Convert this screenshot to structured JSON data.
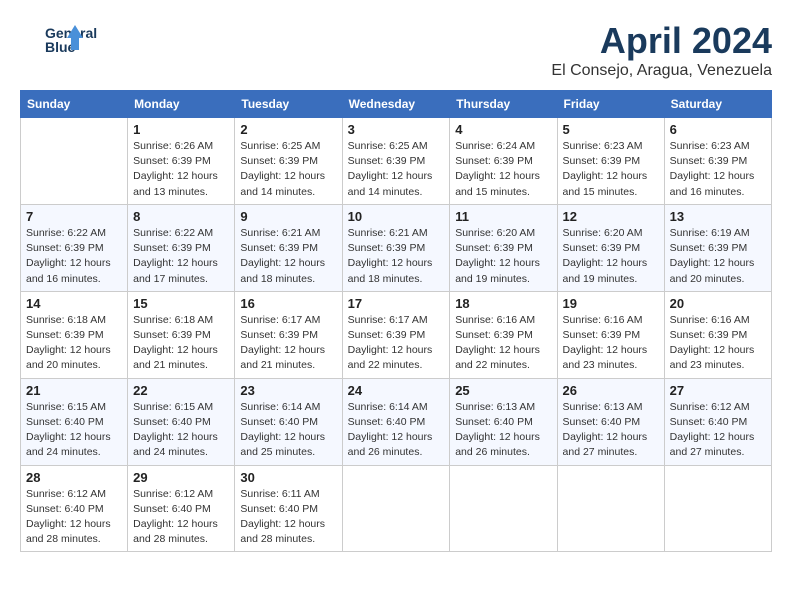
{
  "header": {
    "logo_line1": "General",
    "logo_line2": "Blue",
    "month": "April 2024",
    "location": "El Consejo, Aragua, Venezuela"
  },
  "days_of_week": [
    "Sunday",
    "Monday",
    "Tuesday",
    "Wednesday",
    "Thursday",
    "Friday",
    "Saturday"
  ],
  "weeks": [
    [
      null,
      {
        "day": 1,
        "sunrise": "6:26 AM",
        "sunset": "6:39 PM",
        "daylight": "12 hours and 13 minutes."
      },
      {
        "day": 2,
        "sunrise": "6:25 AM",
        "sunset": "6:39 PM",
        "daylight": "12 hours and 14 minutes."
      },
      {
        "day": 3,
        "sunrise": "6:25 AM",
        "sunset": "6:39 PM",
        "daylight": "12 hours and 14 minutes."
      },
      {
        "day": 4,
        "sunrise": "6:24 AM",
        "sunset": "6:39 PM",
        "daylight": "12 hours and 15 minutes."
      },
      {
        "day": 5,
        "sunrise": "6:23 AM",
        "sunset": "6:39 PM",
        "daylight": "12 hours and 15 minutes."
      },
      {
        "day": 6,
        "sunrise": "6:23 AM",
        "sunset": "6:39 PM",
        "daylight": "12 hours and 16 minutes."
      }
    ],
    [
      {
        "day": 7,
        "sunrise": "6:22 AM",
        "sunset": "6:39 PM",
        "daylight": "12 hours and 16 minutes."
      },
      {
        "day": 8,
        "sunrise": "6:22 AM",
        "sunset": "6:39 PM",
        "daylight": "12 hours and 17 minutes."
      },
      {
        "day": 9,
        "sunrise": "6:21 AM",
        "sunset": "6:39 PM",
        "daylight": "12 hours and 18 minutes."
      },
      {
        "day": 10,
        "sunrise": "6:21 AM",
        "sunset": "6:39 PM",
        "daylight": "12 hours and 18 minutes."
      },
      {
        "day": 11,
        "sunrise": "6:20 AM",
        "sunset": "6:39 PM",
        "daylight": "12 hours and 19 minutes."
      },
      {
        "day": 12,
        "sunrise": "6:20 AM",
        "sunset": "6:39 PM",
        "daylight": "12 hours and 19 minutes."
      },
      {
        "day": 13,
        "sunrise": "6:19 AM",
        "sunset": "6:39 PM",
        "daylight": "12 hours and 20 minutes."
      }
    ],
    [
      {
        "day": 14,
        "sunrise": "6:18 AM",
        "sunset": "6:39 PM",
        "daylight": "12 hours and 20 minutes."
      },
      {
        "day": 15,
        "sunrise": "6:18 AM",
        "sunset": "6:39 PM",
        "daylight": "12 hours and 21 minutes."
      },
      {
        "day": 16,
        "sunrise": "6:17 AM",
        "sunset": "6:39 PM",
        "daylight": "12 hours and 21 minutes."
      },
      {
        "day": 17,
        "sunrise": "6:17 AM",
        "sunset": "6:39 PM",
        "daylight": "12 hours and 22 minutes."
      },
      {
        "day": 18,
        "sunrise": "6:16 AM",
        "sunset": "6:39 PM",
        "daylight": "12 hours and 22 minutes."
      },
      {
        "day": 19,
        "sunrise": "6:16 AM",
        "sunset": "6:39 PM",
        "daylight": "12 hours and 23 minutes."
      },
      {
        "day": 20,
        "sunrise": "6:16 AM",
        "sunset": "6:39 PM",
        "daylight": "12 hours and 23 minutes."
      }
    ],
    [
      {
        "day": 21,
        "sunrise": "6:15 AM",
        "sunset": "6:40 PM",
        "daylight": "12 hours and 24 minutes."
      },
      {
        "day": 22,
        "sunrise": "6:15 AM",
        "sunset": "6:40 PM",
        "daylight": "12 hours and 24 minutes."
      },
      {
        "day": 23,
        "sunrise": "6:14 AM",
        "sunset": "6:40 PM",
        "daylight": "12 hours and 25 minutes."
      },
      {
        "day": 24,
        "sunrise": "6:14 AM",
        "sunset": "6:40 PM",
        "daylight": "12 hours and 26 minutes."
      },
      {
        "day": 25,
        "sunrise": "6:13 AM",
        "sunset": "6:40 PM",
        "daylight": "12 hours and 26 minutes."
      },
      {
        "day": 26,
        "sunrise": "6:13 AM",
        "sunset": "6:40 PM",
        "daylight": "12 hours and 27 minutes."
      },
      {
        "day": 27,
        "sunrise": "6:12 AM",
        "sunset": "6:40 PM",
        "daylight": "12 hours and 27 minutes."
      }
    ],
    [
      {
        "day": 28,
        "sunrise": "6:12 AM",
        "sunset": "6:40 PM",
        "daylight": "12 hours and 28 minutes."
      },
      {
        "day": 29,
        "sunrise": "6:12 AM",
        "sunset": "6:40 PM",
        "daylight": "12 hours and 28 minutes."
      },
      {
        "day": 30,
        "sunrise": "6:11 AM",
        "sunset": "6:40 PM",
        "daylight": "12 hours and 28 minutes."
      },
      null,
      null,
      null,
      null
    ]
  ]
}
